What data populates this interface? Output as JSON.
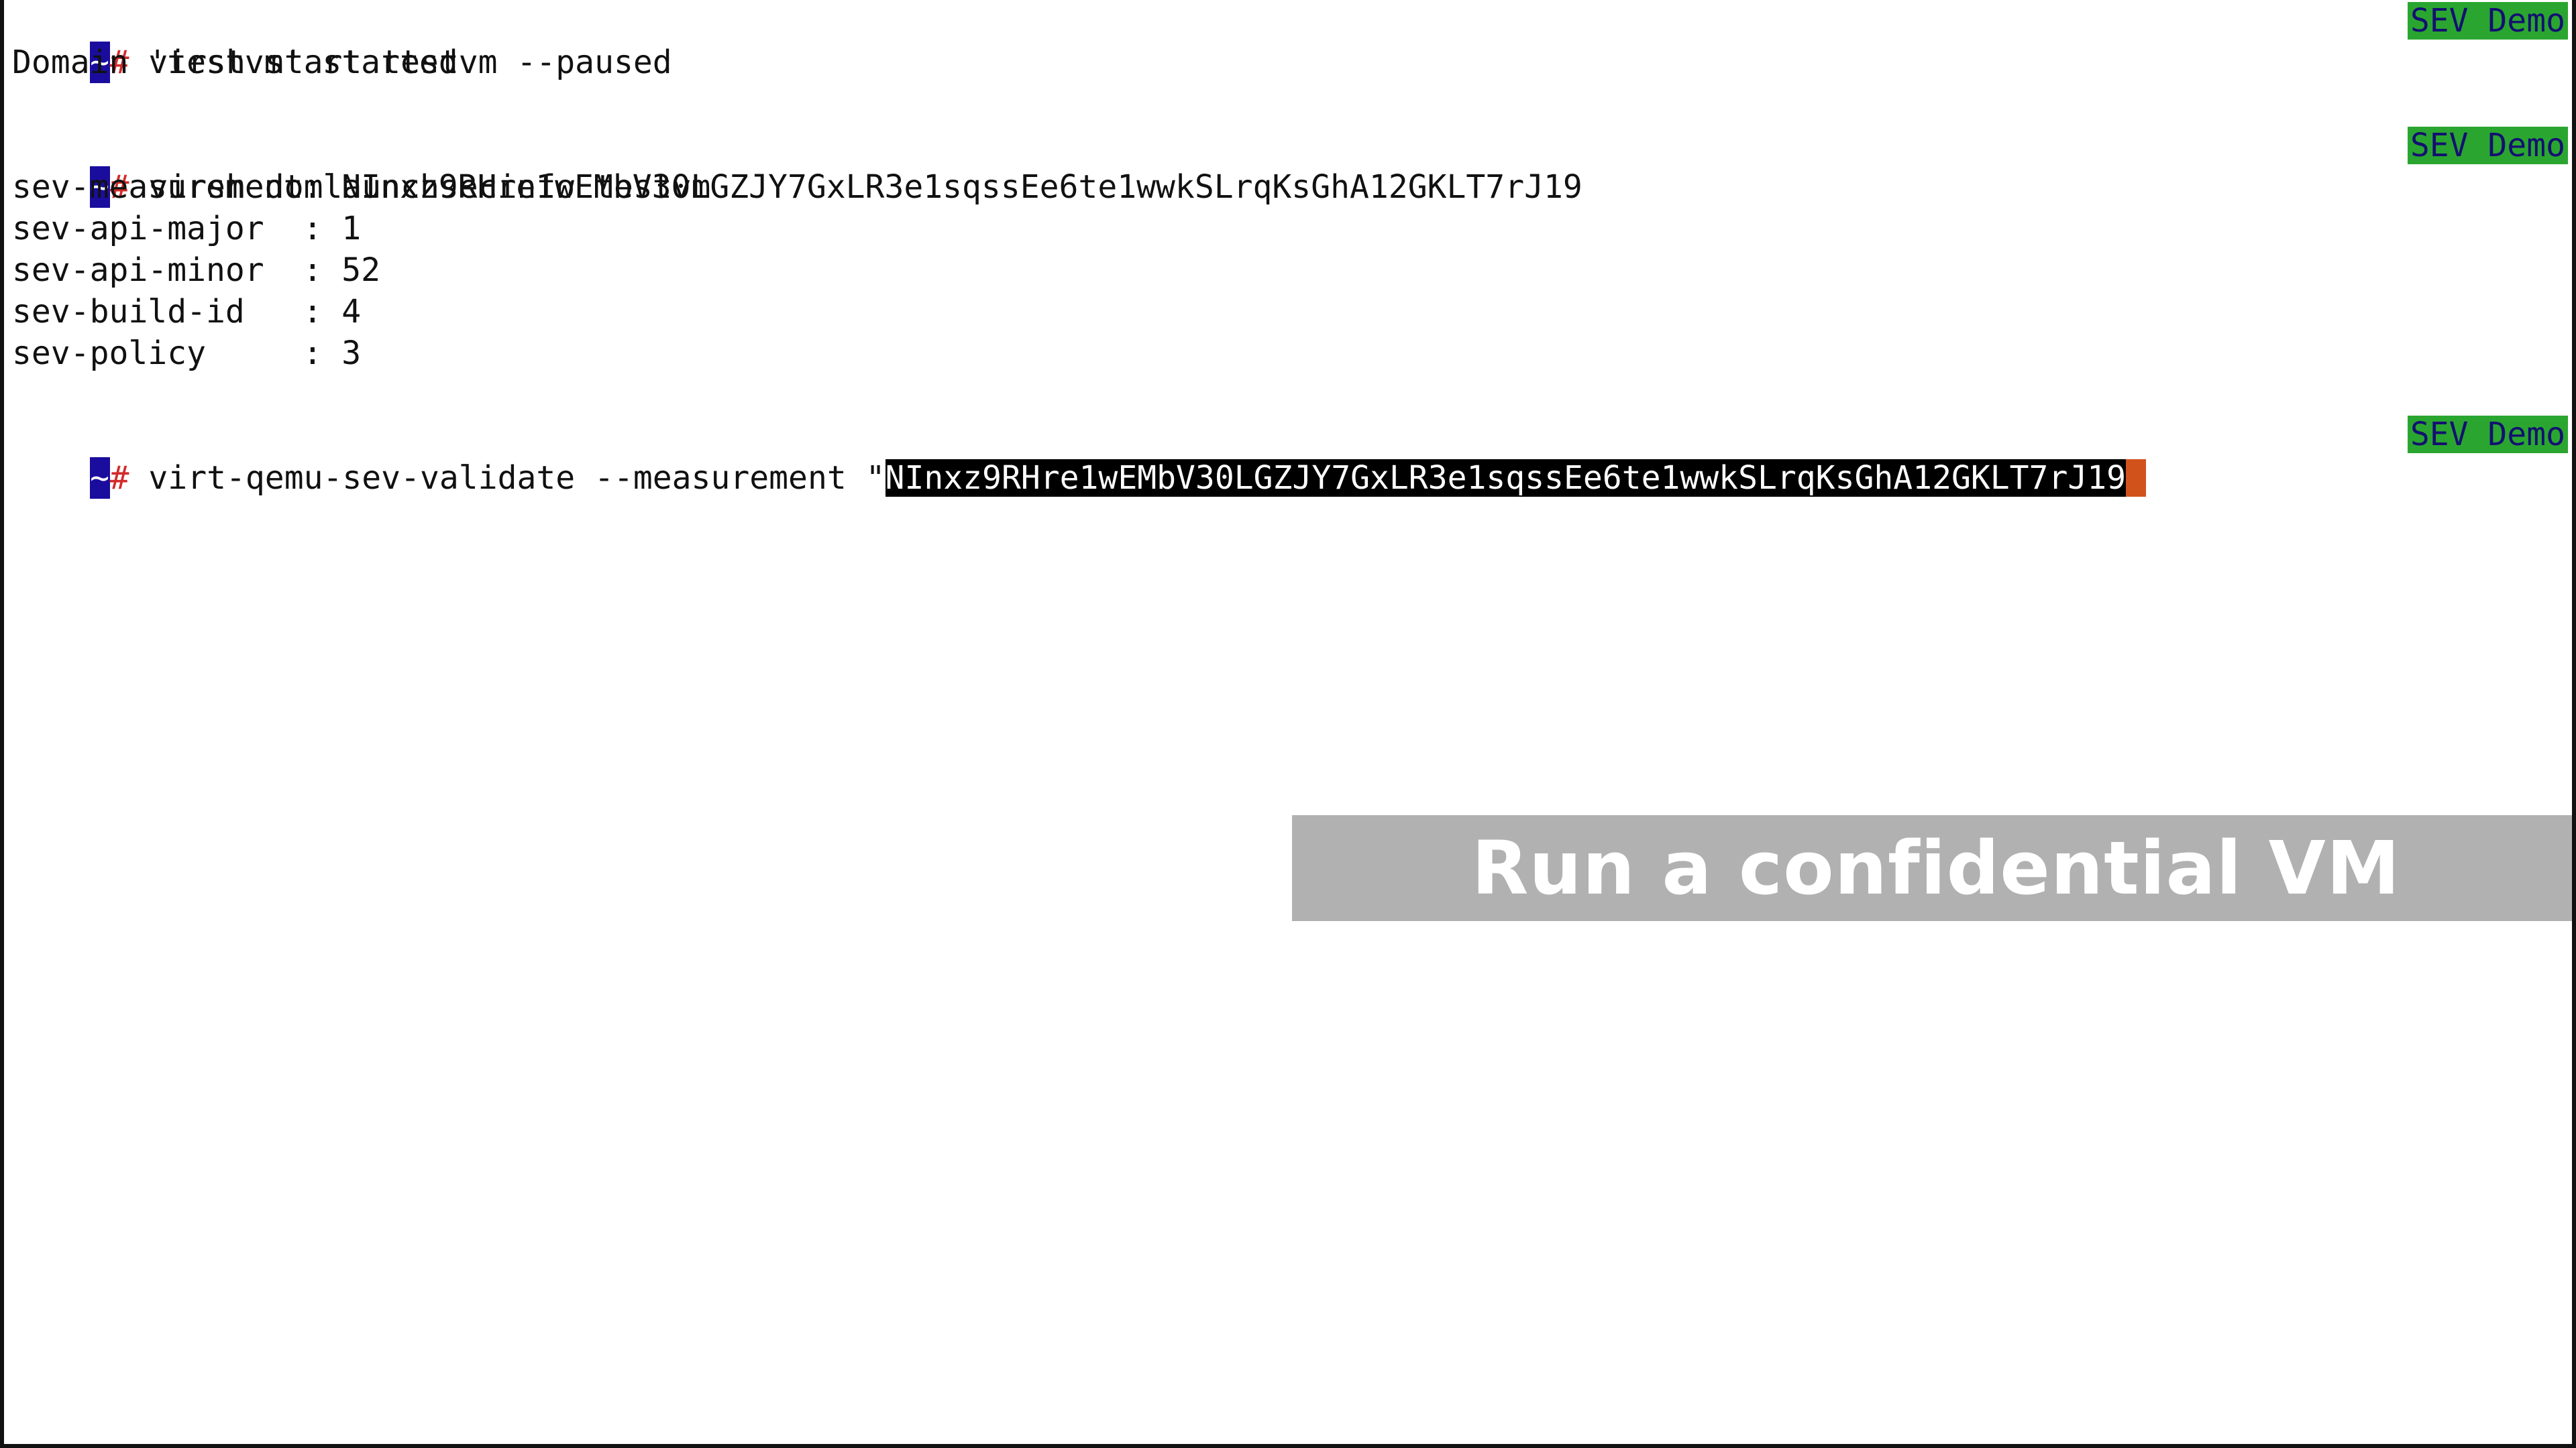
{
  "terminal": {
    "prompt": {
      "tilde": "~",
      "hash": "#"
    },
    "command1": " virsh start testvm --paused",
    "output1": "Domain 'testvm' started",
    "command2": " virsh domlaunchsecinfo testvm",
    "info": [
      {
        "key": "sev-measurement",
        "sep": ": ",
        "value": "NInxz9RHre1wEMbV30LGZJY7GxLR3e1sqssEe6te1wwkSLrqKsGhA12GKLT7rJ19"
      },
      {
        "key": "sev-api-major  ",
        "sep": ": ",
        "value": "1"
      },
      {
        "key": "sev-api-minor  ",
        "sep": ": ",
        "value": "52"
      },
      {
        "key": "sev-build-id   ",
        "sep": ": ",
        "value": "4"
      },
      {
        "key": "sev-policy     ",
        "sep": ": ",
        "value": "3"
      }
    ],
    "command3_prefix": " virt-qemu-sev-validate --measurement \"",
    "command3_selected": "NInxz9RHre1wEMbV30LGZJY7GxLR3e1sqssEe6te1wwkSLrqKsGhA12GKLT7rJ19"
  },
  "badge": {
    "label": "SEV Demo"
  },
  "overlay": {
    "title": "Run a confidential VM"
  },
  "colors": {
    "prompt_tilde_bg": "#1a0d9e",
    "prompt_hash": "#d32b2b",
    "badge_bg": "#2aa630",
    "badge_text": "#141070",
    "cursor": "#d2521c",
    "overlay_bg": "#b1b1b1"
  }
}
